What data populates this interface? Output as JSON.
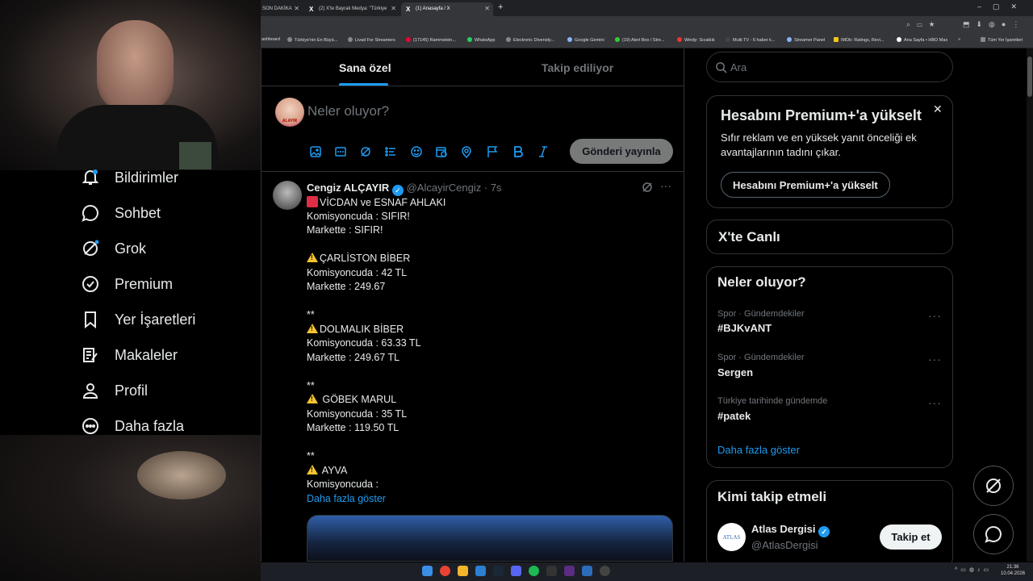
{
  "browser": {
    "tabs": [
      {
        "label": "SON DAKİKA"
      },
      {
        "label": "(2) X'te Bayrak Medya: \"Türkiye"
      },
      {
        "label": "(1) Anasayfa / X"
      }
    ],
    "bookmarks": [
      "ashboard",
      "Türkiye'nin En Büyü...",
      "Livad For Streamers",
      "(17145) Rammstein...",
      "WhatsApp",
      "Electronic Diversity...",
      "Google Gemini",
      "(19) Alert Box / Stre...",
      "Windy: Sıcaklık",
      "Multi TV - 6 haber k...",
      "Streamer Panel",
      "IMDb: Ratings, Revi...",
      "Ana Sayfa • HBO Max",
      "Tüm Yer İşaretleri"
    ]
  },
  "nav": {
    "items": [
      {
        "label": "Bildirimler",
        "icon": "bell-icon"
      },
      {
        "label": "Sohbet",
        "icon": "chat-icon"
      },
      {
        "label": "Grok",
        "icon": "grok-icon"
      },
      {
        "label": "Premium",
        "icon": "premium-icon"
      },
      {
        "label": "Yer İşaretleri",
        "icon": "bookmark-icon"
      },
      {
        "label": "Makaleler",
        "icon": "article-icon"
      },
      {
        "label": "Profil",
        "icon": "profile-icon"
      },
      {
        "label": "Daha fazla",
        "icon": "more-icon"
      }
    ]
  },
  "feed": {
    "tabs": [
      {
        "label": "Sana özel",
        "active": true
      },
      {
        "label": "Takip ediliyor",
        "active": false
      }
    ],
    "composer": {
      "placeholder": "Neler oluyor?",
      "avatar_text": "ALAYIR",
      "post_label": "Gönderi yayınla"
    },
    "tweet": {
      "author": "Cengiz ALÇAYIR",
      "handle": "@AlcayirCengiz",
      "time": "· 7s",
      "lines": [
        "VİCDAN ve ESNAF AHLAKI",
        "Komisyoncuda : SIFIR!",
        "Markette : SIFIR!",
        "",
        "ÇARLİSTON BİBER",
        "Komisyoncuda : 42 TL",
        "Markette : 249.67",
        "",
        "**",
        "DOLMALIK BİBER",
        "Komisyoncuda : 63.33 TL",
        "Markette : 249.67  TL",
        "",
        "**",
        " GÖBEK MARUL",
        "Komisyoncuda : 35 TL",
        "Markette : 119.50 TL",
        "",
        "**",
        " AYVA",
        "Komisyoncuda :"
      ],
      "show_more": "Daha fazla göster"
    }
  },
  "sidebar": {
    "search_placeholder": "Ara",
    "premium": {
      "title": "Hesabını Premium+'a yükselt",
      "body": "Sıfır reklam ve en yüksek yanıt önceliği ek avantajlarının tadını çıkar.",
      "button": "Hesabını Premium+'a yükselt"
    },
    "live": {
      "title": "X'te Canlı"
    },
    "trends": {
      "title": "Neler oluyor?",
      "items": [
        {
          "category": "Spor · Gündemdekiler",
          "name": "#BJKvANT"
        },
        {
          "category": "Spor · Gündemdekiler",
          "name": "Sergen"
        },
        {
          "category": "Türkiye tarihinde gündemde",
          "name": "#patek"
        }
      ],
      "show_more": "Daha fazla göster"
    },
    "follow": {
      "title": "Kimi takip etmeli",
      "items": [
        {
          "name": "Atlas Dergisi",
          "handle": "@AtlasDergisi",
          "button": "Takip et",
          "avatar_text": "ATLAS"
        }
      ]
    }
  },
  "taskbar": {
    "time": "21:36",
    "date": "10.04.2026"
  },
  "colors": {
    "accent": "#1d9bf0",
    "background": "#000000",
    "border": "#2f3336",
    "muted": "#71767b"
  }
}
